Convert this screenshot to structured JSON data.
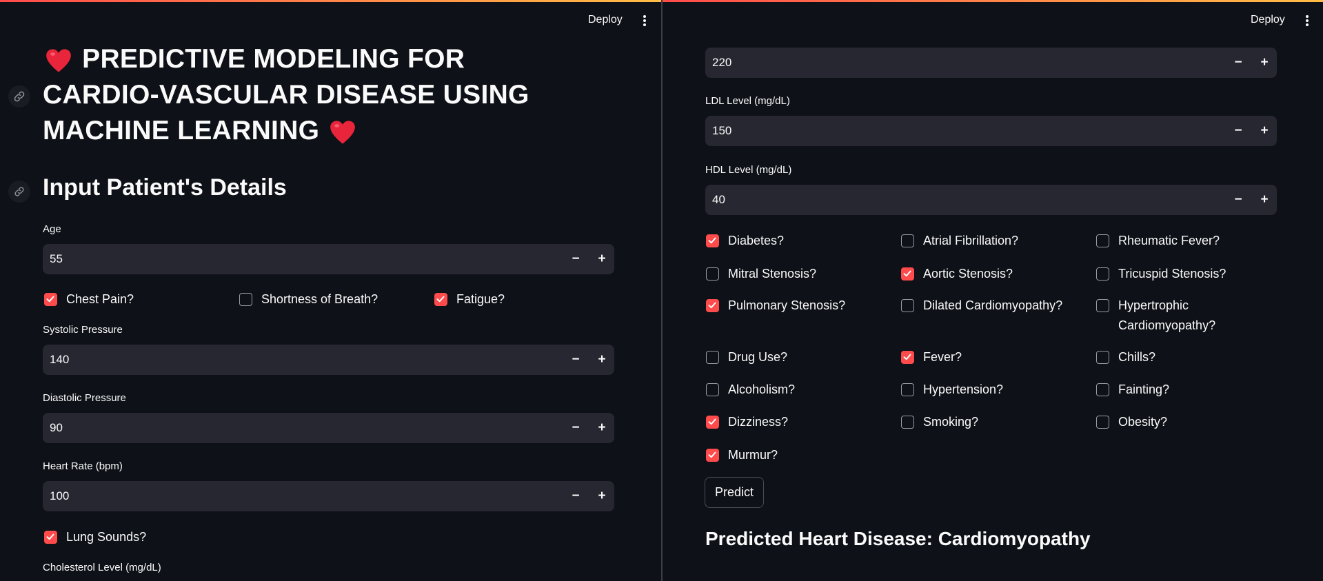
{
  "header": {
    "deploy_label": "Deploy"
  },
  "left": {
    "title": "PREDICTIVE MODELING FOR CARDIO-VASCULAR DISEASE USING MACHINE LEARNING",
    "subtitle": "Input Patient's Details",
    "age": {
      "label": "Age",
      "value": "55"
    },
    "symptoms": [
      {
        "label": "Chest Pain?",
        "checked": true
      },
      {
        "label": "Shortness of Breath?",
        "checked": false
      },
      {
        "label": "Fatigue?",
        "checked": true
      }
    ],
    "systolic": {
      "label": "Systolic Pressure",
      "value": "140"
    },
    "diastolic": {
      "label": "Diastolic Pressure",
      "value": "90"
    },
    "heart_rate": {
      "label": "Heart Rate (bpm)",
      "value": "100"
    },
    "lung_sounds": {
      "label": "Lung Sounds?",
      "checked": true
    },
    "cholesterol_label": "Cholesterol Level (mg/dL)"
  },
  "right": {
    "cholesterol_value": "220",
    "ldl": {
      "label": "LDL Level (mg/dL)",
      "value": "150"
    },
    "hdl": {
      "label": "HDL Level (mg/dL)",
      "value": "40"
    },
    "conditions": [
      {
        "label": "Diabetes?",
        "checked": true
      },
      {
        "label": "Atrial Fibrillation?",
        "checked": false
      },
      {
        "label": "Rheumatic Fever?",
        "checked": false
      },
      {
        "label": "Mitral Stenosis?",
        "checked": false
      },
      {
        "label": "Aortic Stenosis?",
        "checked": true
      },
      {
        "label": "Tricuspid Stenosis?",
        "checked": false
      },
      {
        "label": "Pulmonary Stenosis?",
        "checked": true
      },
      {
        "label": "Dilated Cardiomyopathy?",
        "checked": false
      },
      {
        "label": "Hypertrophic Cardiomyopathy?",
        "checked": false
      },
      {
        "label": "Drug Use?",
        "checked": false
      },
      {
        "label": "Fever?",
        "checked": true
      },
      {
        "label": "Chills?",
        "checked": false
      },
      {
        "label": "Alcoholism?",
        "checked": false
      },
      {
        "label": "Hypertension?",
        "checked": false
      },
      {
        "label": "Fainting?",
        "checked": false
      },
      {
        "label": "Dizziness?",
        "checked": true
      },
      {
        "label": "Smoking?",
        "checked": false
      },
      {
        "label": "Obesity?",
        "checked": false
      },
      {
        "label": "Murmur?",
        "checked": true
      }
    ],
    "predict_label": "Predict",
    "result": "Predicted Heart Disease: Cardiomyopathy"
  },
  "stepper": {
    "minus": "−",
    "plus": "+"
  },
  "colors": {
    "background": "#0e1117",
    "input_bg": "#262730",
    "accent": "#ff4b4b"
  },
  "icons": [
    "link-icon",
    "heart-icon",
    "kebab-menu-icon",
    "checkmark-icon"
  ]
}
